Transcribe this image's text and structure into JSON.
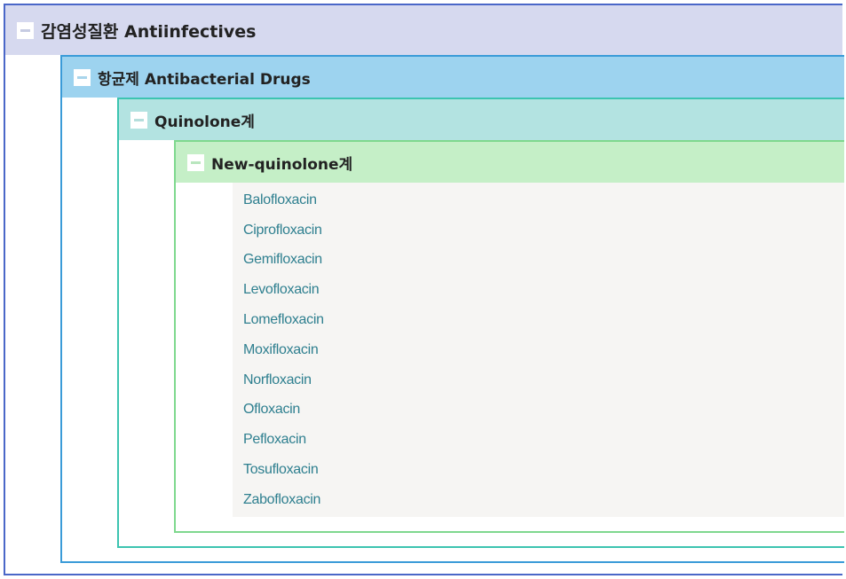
{
  "tree": {
    "level1": {
      "label": "감염성질환 Antiinfectives",
      "toggle": "collapse",
      "bg": "#d6d9ef",
      "border": "#4a67c8"
    },
    "level2": {
      "label": "항균제 Antibacterial Drugs",
      "toggle": "collapse",
      "bg": "#9dd3ef",
      "border": "#3a9bd8"
    },
    "level3": {
      "label": "Quinolone계",
      "toggle": "collapse",
      "bg": "#b3e3e1",
      "border": "#3cc4b0"
    },
    "level4": {
      "label": "New-quinolone계",
      "toggle": "collapse",
      "bg": "#c5efc7",
      "border": "#7fd88e"
    },
    "drugs": [
      "Balofloxacin",
      "Ciprofloxacin",
      "Gemifloxacin",
      "Levofloxacin",
      "Lomefloxacin",
      "Moxifloxacin",
      "Norfloxacin",
      "Ofloxacin",
      "Pefloxacin",
      "Tosufloxacin",
      "Zabofloxacin"
    ],
    "link_color": "#2e7f8f"
  }
}
